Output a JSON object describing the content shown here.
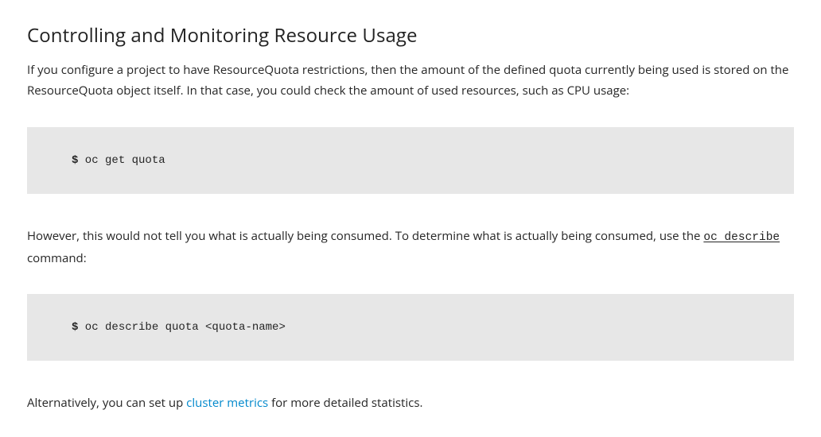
{
  "heading": "Controlling and Monitoring Resource Usage",
  "intro": "If you configure a project to have ResourceQuota restrictions, then the amount of the defined quota currently being used is stored on the ResourceQuota object itself. In that case, you could check the amount of used resources, such as CPU usage:",
  "code1": {
    "prompt": "$",
    "command": " oc get quota"
  },
  "para2_pre": "However, this would not tell you what is actually being consumed. To determine what is actually being consumed, use the ",
  "para2_code": "oc describe",
  "para2_post": " command:",
  "code2": {
    "prompt": "$",
    "command": " oc describe quota <quota-name>"
  },
  "para3_pre": "Alternatively, you can set up ",
  "para3_link": "cluster metrics",
  "para3_post": " for more detailed statistics."
}
